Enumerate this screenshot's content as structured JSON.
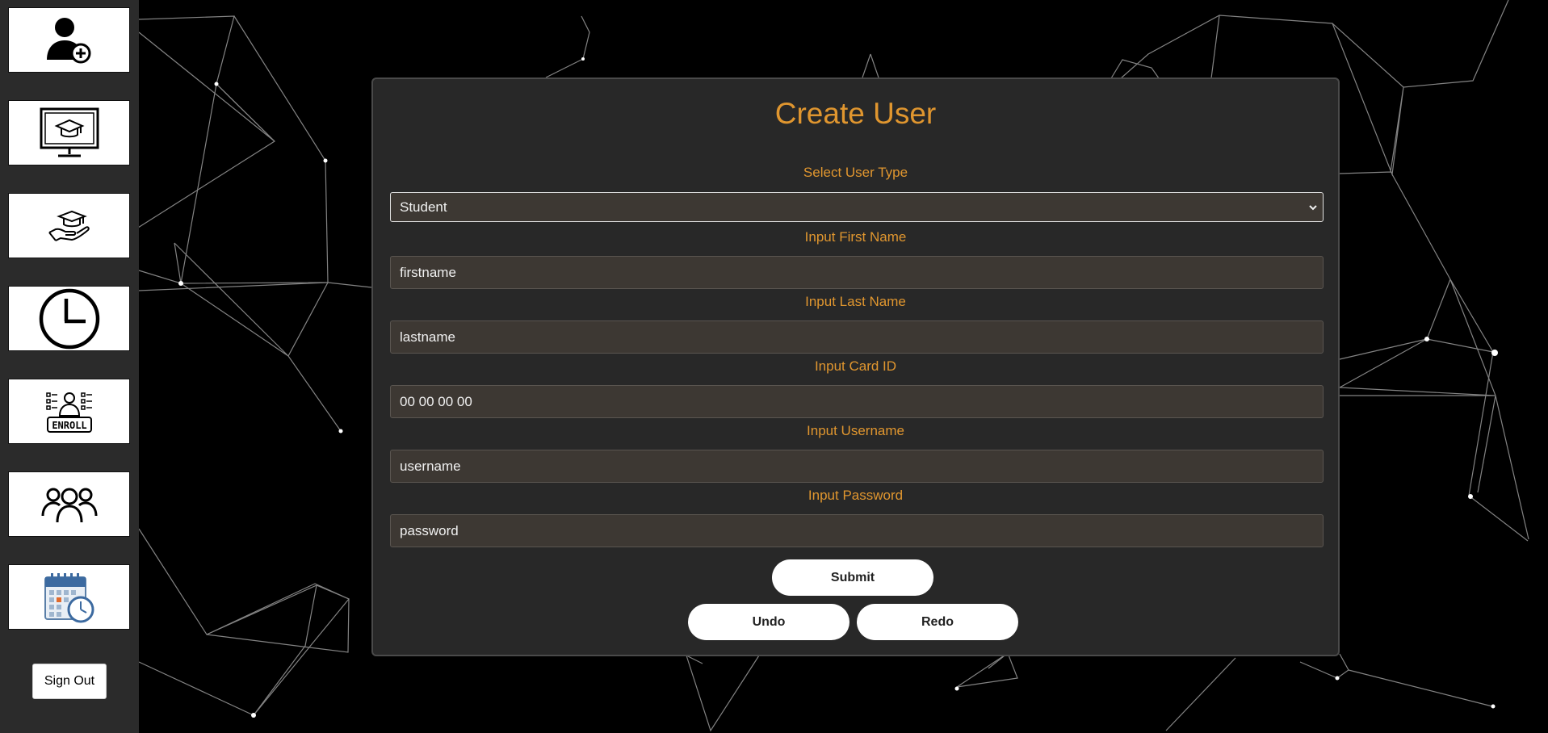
{
  "form": {
    "title": "Create User",
    "user_type": {
      "label": "Select User Type",
      "value": "Student"
    },
    "first_name": {
      "label": "Input First Name",
      "placeholder": "firstname"
    },
    "last_name": {
      "label": "Input Last Name",
      "placeholder": "lastname"
    },
    "card_id": {
      "label": "Input Card ID",
      "placeholder": "00 00 00 00"
    },
    "username": {
      "label": "Input Username",
      "placeholder": "username"
    },
    "password": {
      "label": "Input Password",
      "placeholder": "password"
    },
    "submit_label": "Submit",
    "undo_label": "Undo",
    "redo_label": "Redo"
  },
  "sidebar": {
    "items": [
      {
        "icon": "add-user-icon"
      },
      {
        "icon": "online-education-icon"
      },
      {
        "icon": "scholarship-hand-icon"
      },
      {
        "icon": "clock-icon"
      },
      {
        "icon": "enroll-icon"
      },
      {
        "icon": "group-icon"
      },
      {
        "icon": "calendar-clock-icon"
      }
    ],
    "signout_label": "Sign Out"
  },
  "colors": {
    "accent": "#e0962f",
    "panel": "#282828",
    "field": "#3d3833",
    "sidebar": "#2b2b2b",
    "background": "#000000"
  }
}
